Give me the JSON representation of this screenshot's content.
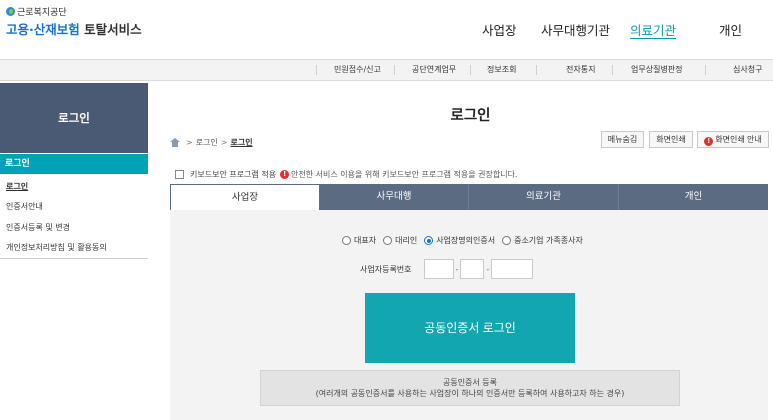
{
  "header": {
    "org": "근로복지공단",
    "title_part1": "고용·산재보험",
    "title_part2": " 토탈서비스",
    "nav": [
      "사업장",
      "사무대행기관",
      "의료기관",
      "개인"
    ]
  },
  "submenu": [
    "민원접수/신고",
    "공단연계업무",
    "정보조회",
    "전자통지",
    "업무상질병판정",
    "심사청구"
  ],
  "sidebar": {
    "banner": "로그인",
    "active": "로그인",
    "items": [
      "로그인",
      "인증서안내",
      "인증서등록 및 변경",
      "개인정보처리방침 및 활용동의"
    ]
  },
  "main": {
    "title": "로그인",
    "breadcrumb": [
      "로그인",
      "로그인"
    ],
    "utility_buttons": [
      "메뉴숨김",
      "화면인쇄",
      "화면인쇄 안내"
    ],
    "keyboard_security": {
      "label": "키보드보안 프로그램 적용",
      "warning": "안전한 서비스 이용을 위해 키보드보안 프로그램 적용을 권장합니다."
    },
    "tabs": [
      "사업장",
      "사무대행",
      "의료기관",
      "개인"
    ],
    "radios": [
      "대표자",
      "대리인",
      "사업장명의인증서",
      "중소기업 가족종사자"
    ],
    "biz_number_label": "사업자등록번호",
    "cert_login_button": "공동인증서 로그인",
    "cert_register": {
      "title": "공동인증서 등록",
      "desc": "(여러개의 공동인증서를 사용하는 사업장이 하나의 인증서만 등록하여 사용하고자 하는 경우)"
    }
  },
  "colors": {
    "accent": "#00a3b4",
    "tab_bg": "#5b6b82",
    "side_banner": "#4a5a75",
    "warning": "#e03131"
  }
}
